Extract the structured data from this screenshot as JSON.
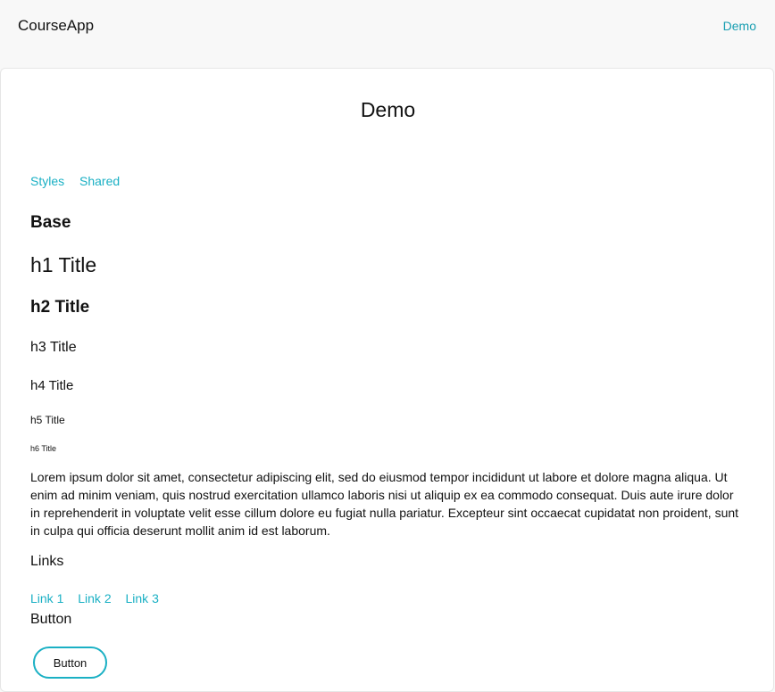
{
  "header": {
    "brand": "CourseApp",
    "nav_link": "Demo"
  },
  "page": {
    "title": "Demo",
    "tabs": [
      "Styles",
      "Shared"
    ]
  },
  "base": {
    "section_title": "Base",
    "h1": "h1 Title",
    "h2": "h2 Title",
    "h3": "h3 Title",
    "h4": "h4 Title",
    "h5": "h5 Title",
    "h6": "h6 Title",
    "paragraph": "Lorem ipsum dolor sit amet, consectetur adipiscing elit, sed do eiusmod tempor incididunt ut labore et dolore magna aliqua. Ut enim ad minim veniam, quis nostrud exercitation ullamco laboris nisi ut aliquip ex ea commodo consequat. Duis aute irure dolor in reprehenderit in voluptate velit esse cillum dolore eu fugiat nulla pariatur. Excepteur sint occaecat cupidatat non proident, sunt in culpa qui officia deserunt mollit anim id est laborum."
  },
  "links": {
    "title": "Links",
    "items": [
      "Link 1",
      "Link 2",
      "Link 3"
    ]
  },
  "button": {
    "title": "Button",
    "label": "Button"
  },
  "colors": {
    "accent": "#1ab0c4",
    "nav_link": "#1a9fb2",
    "background": "#f8f8f8",
    "card": "#ffffff"
  }
}
